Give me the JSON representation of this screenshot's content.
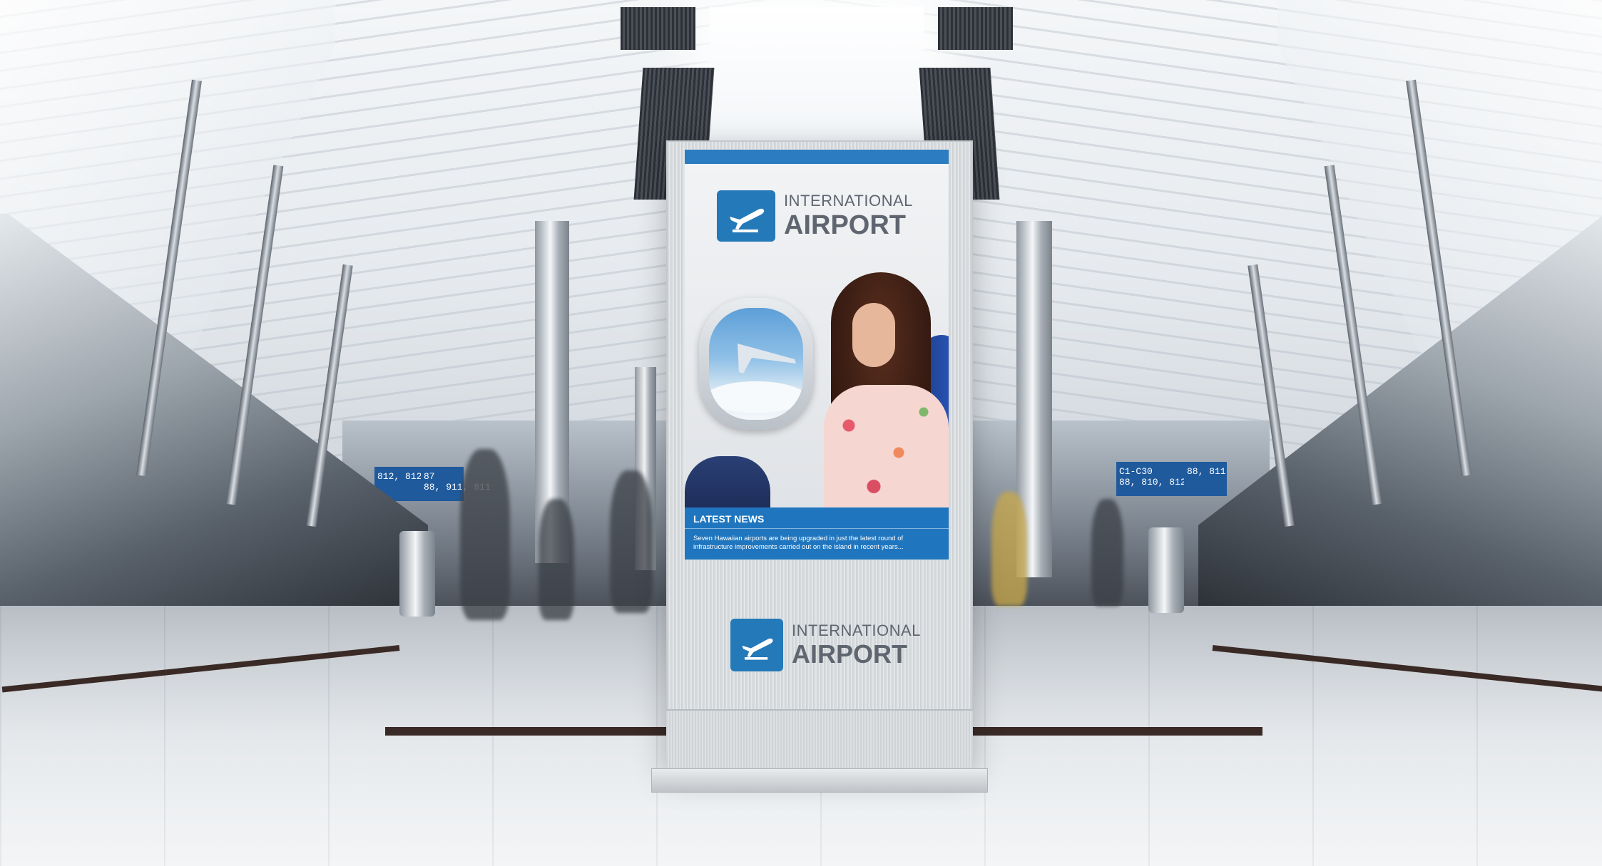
{
  "kiosk": {
    "screen": {
      "logo": {
        "line1": "INTERNATIONAL",
        "line2": "AIRPORT"
      },
      "news": {
        "title": "LATEST NEWS",
        "body": "Seven Hawaiian airports are being upgraded in just the latest round of infrastructure improvements carried out on the island in recent years..."
      }
    },
    "panel_logo": {
      "line1": "INTERNATIONAL",
      "line2": "AIRPORT"
    }
  },
  "background_signs": [
    {
      "text": "87\n88, 911, 811"
    },
    {
      "text": "812, 812"
    },
    {
      "text": "C1-C30\n88, 810, 812"
    },
    {
      "text": "88, 811"
    }
  ],
  "colors": {
    "brand_blue": "#2479b8",
    "news_blue": "#1f76bf",
    "logo_gray": "#5f6670"
  }
}
